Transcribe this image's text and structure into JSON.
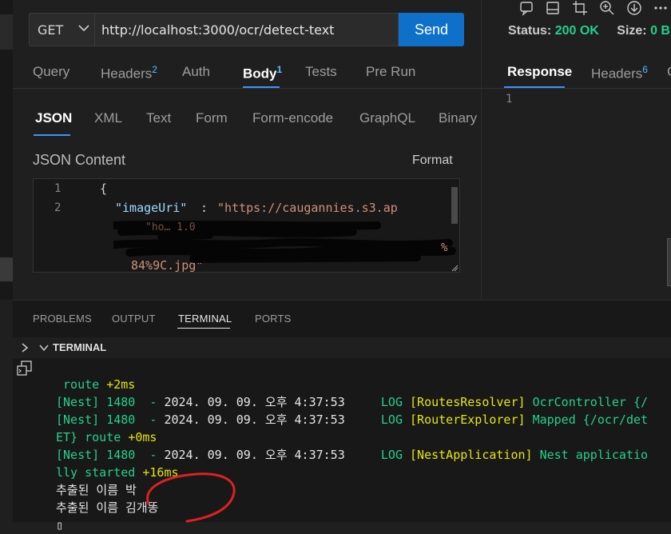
{
  "request": {
    "method": "GET",
    "url": "http://localhost:3000/ocr/detect-text",
    "send_label": "Send",
    "tabs": [
      {
        "label": "Query",
        "count": ""
      },
      {
        "label": "Headers",
        "count": "2"
      },
      {
        "label": "Auth",
        "count": ""
      },
      {
        "label": "Body",
        "count": "1"
      },
      {
        "label": "Tests",
        "count": ""
      },
      {
        "label": "Pre Run",
        "count": ""
      }
    ],
    "body_formats": [
      "JSON",
      "XML",
      "Text",
      "Form",
      "Form-encode",
      "GraphQL",
      "Binary"
    ],
    "json_content_label": "JSON Content",
    "format_label": "Format",
    "editor": {
      "line_numbers": [
        "1",
        "2"
      ],
      "line1": "{",
      "key": "\"imageUri\"",
      "colon": " : ",
      "value_start": "\"https://caugannies.s3.ap",
      "value_end": "84%9C.jpg\""
    }
  },
  "response": {
    "status_label": "Status:",
    "status_value": "200 OK",
    "size_label": "Size:",
    "size_value": "0 B",
    "tabs": [
      {
        "label": "Response",
        "count": ""
      },
      {
        "label": "Headers",
        "count": "6"
      },
      {
        "label": "C",
        "count": ""
      }
    ],
    "line_number": "1",
    "icons": [
      "comment-icon",
      "layout-icon",
      "crop-icon",
      "zoom-in-icon",
      "download-icon",
      "more-icon"
    ]
  },
  "panel": {
    "tabs": [
      "PROBLEMS",
      "OUTPUT",
      "TERMINAL",
      "PORTS"
    ],
    "terminal_title": "TERMINAL",
    "terminal_lines": [
      {
        "parts": [
          {
            "t": " route ",
            "c": "g"
          },
          {
            "t": "+2ms",
            "c": "y"
          }
        ]
      },
      {
        "parts": [
          {
            "t": "[Nest] 1480  - ",
            "c": "g"
          },
          {
            "t": "2024. 09. 09. 오후 4:37:53",
            "c": "w"
          },
          {
            "t": "     LOG ",
            "c": "g"
          },
          {
            "t": "[RoutesResolver] ",
            "c": "y"
          },
          {
            "t": "OcrController {/",
            "c": "g"
          }
        ]
      },
      {
        "parts": [
          {
            "t": "[Nest] 1480  - ",
            "c": "g"
          },
          {
            "t": "2024. 09. 09. 오후 4:37:53",
            "c": "w"
          },
          {
            "t": "     LOG ",
            "c": "g"
          },
          {
            "t": "[RouterExplorer] ",
            "c": "y"
          },
          {
            "t": "Mapped {/ocr/det",
            "c": "g"
          }
        ]
      },
      {
        "parts": [
          {
            "t": "ET} route ",
            "c": "g"
          },
          {
            "t": "+0ms",
            "c": "y"
          }
        ]
      },
      {
        "parts": [
          {
            "t": "[Nest] 1480  - ",
            "c": "g"
          },
          {
            "t": "2024. 09. 09. 오후 4:37:53",
            "c": "w"
          },
          {
            "t": "     LOG ",
            "c": "g"
          },
          {
            "t": "[NestApplication] ",
            "c": "y"
          },
          {
            "t": "Nest applicatio",
            "c": "g"
          }
        ]
      },
      {
        "parts": [
          {
            "t": "lly started ",
            "c": "g"
          },
          {
            "t": "+16ms",
            "c": "y"
          }
        ]
      },
      {
        "parts": [
          {
            "t": "추출된 이름 박",
            "c": "w"
          }
        ]
      },
      {
        "parts": [
          {
            "t": "추출된 이름 김개똥",
            "c": "w"
          }
        ]
      },
      {
        "parts": [
          {
            "t": "▯",
            "c": "w"
          }
        ]
      }
    ]
  },
  "colors": {
    "accent": "#0e70c8",
    "status_ok": "#23d18b",
    "tab_badge": "#4fc1ff",
    "annotation": "#e02020"
  }
}
